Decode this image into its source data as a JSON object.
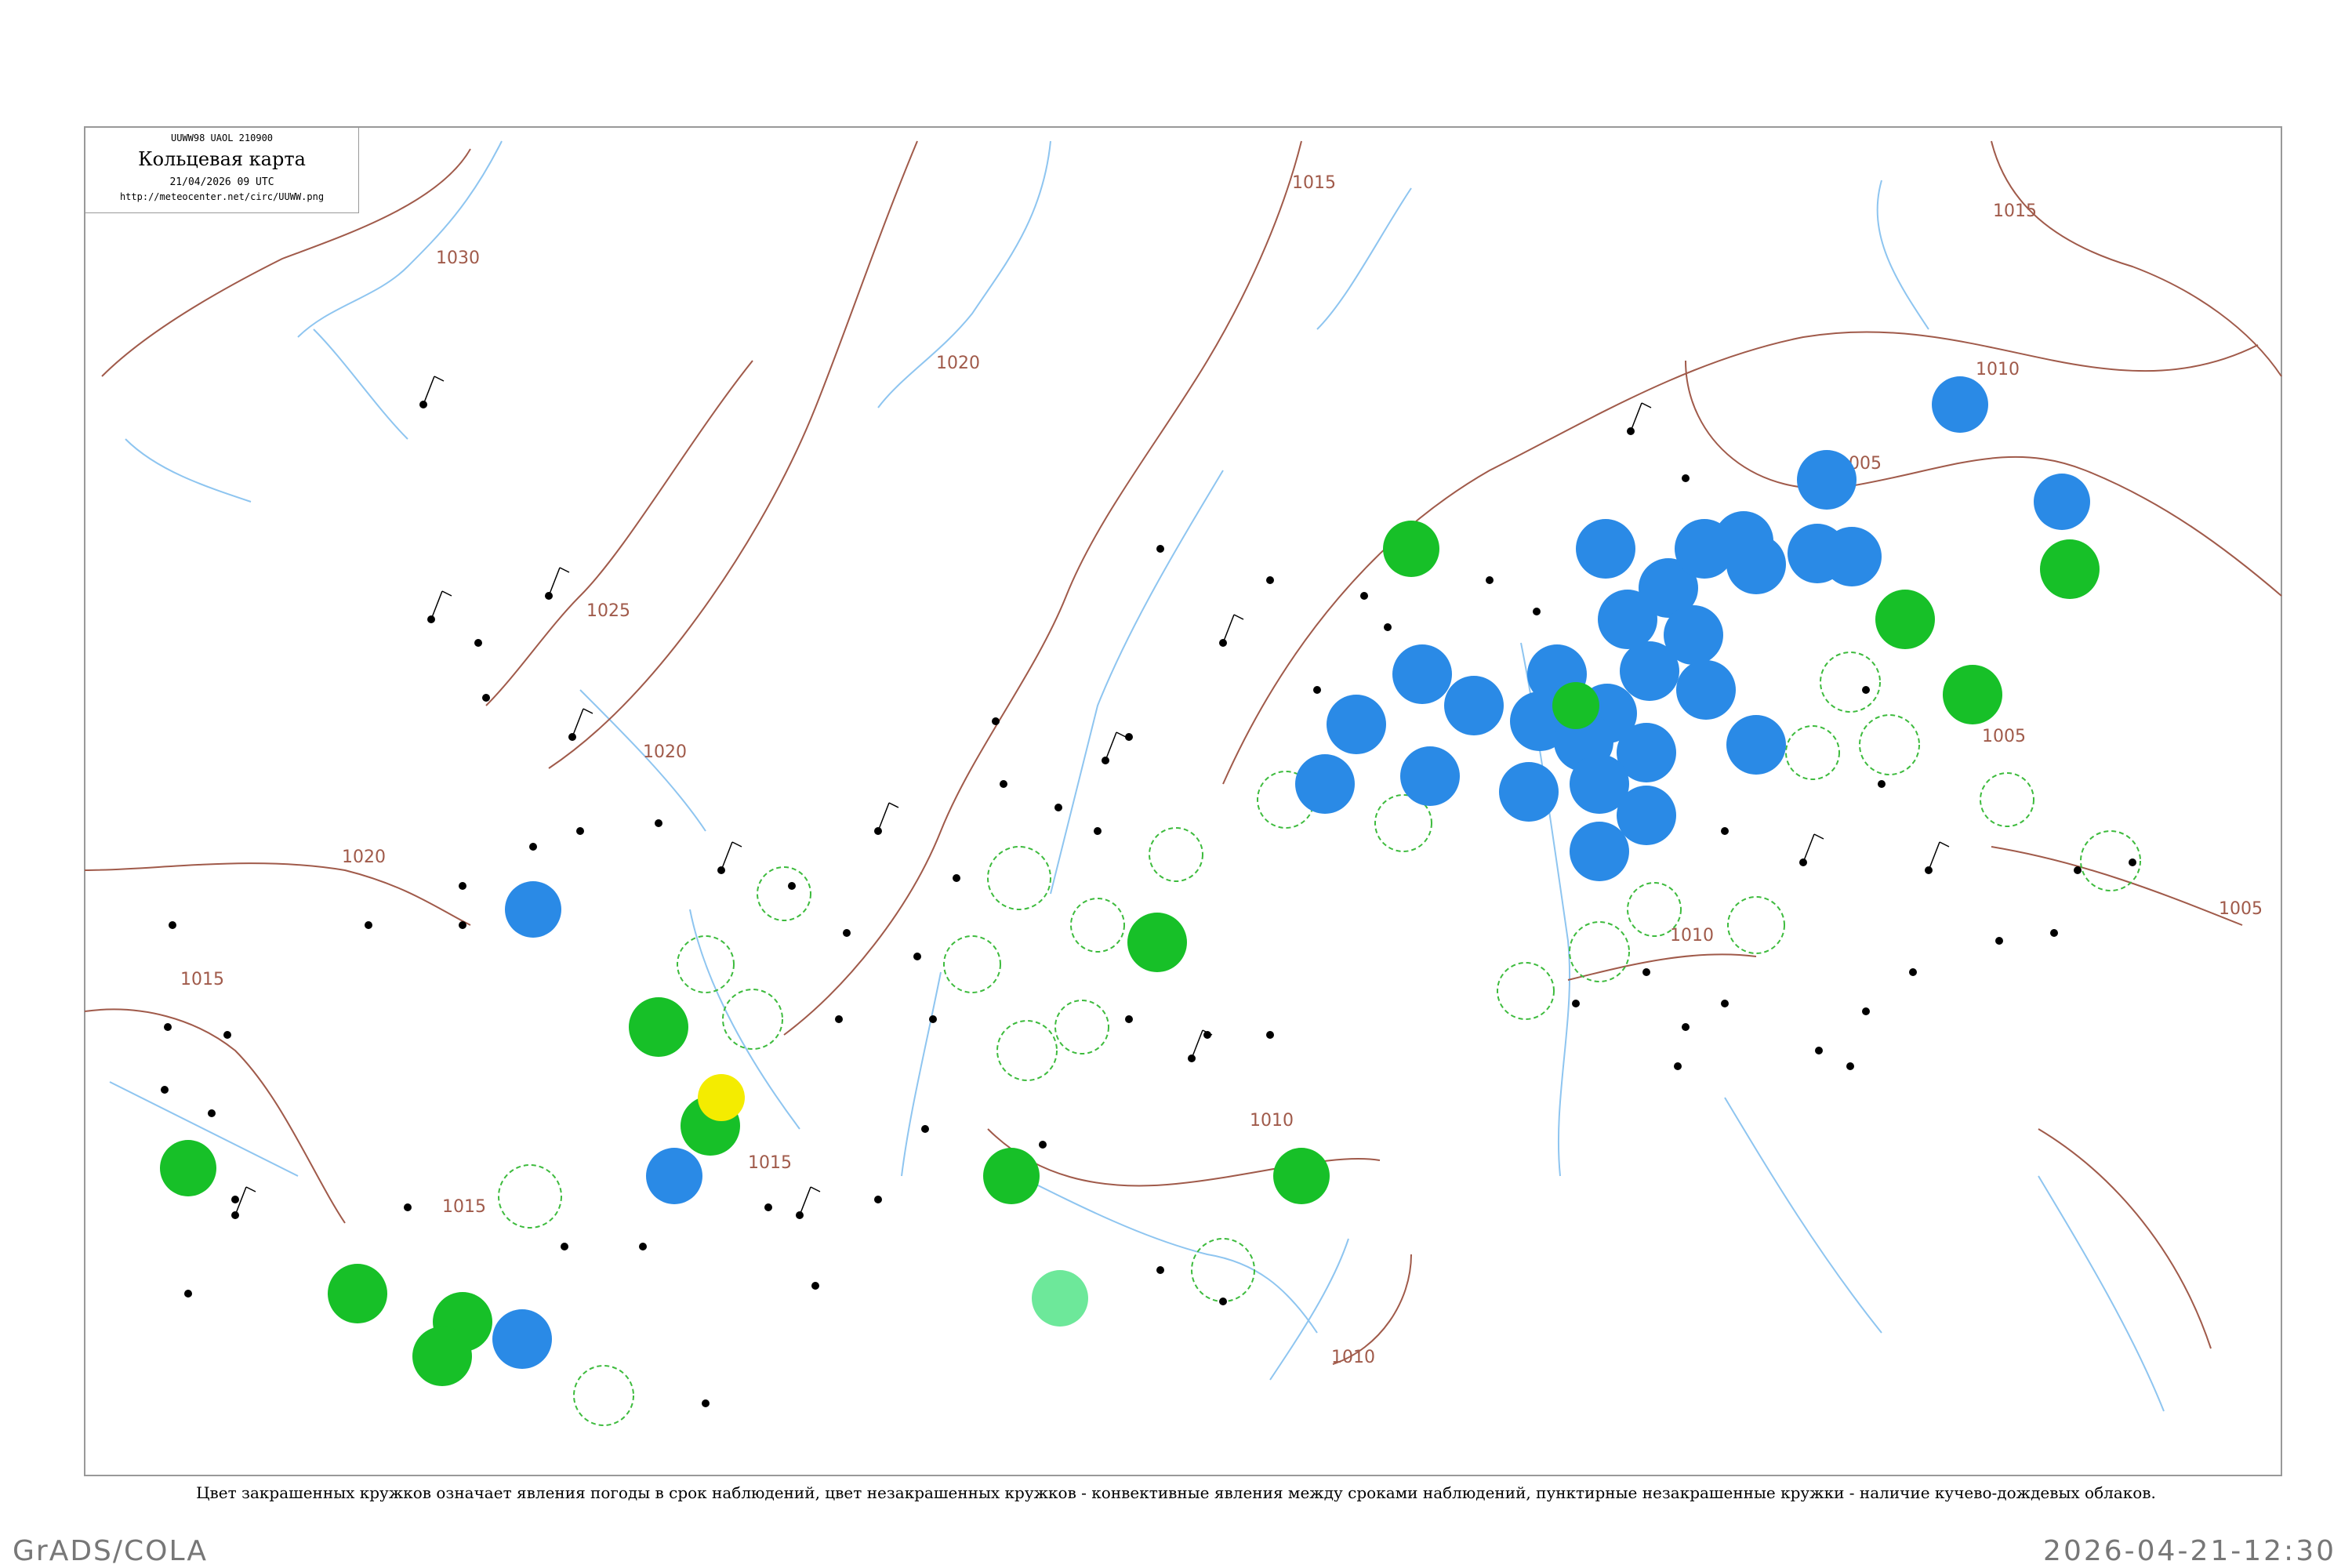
{
  "header": {
    "code": "UUWW98  UAOL  210900",
    "title": "Кольцевая карта",
    "date": "21/04/2026 09 UTC",
    "url": "http://meteocenter.net/circ/UUWW.png"
  },
  "isobars": [
    "1030",
    "1025",
    "1020",
    "1020",
    "1020",
    "1015",
    "1015",
    "1015",
    "1015",
    "1015",
    "1010",
    "1010",
    "1010",
    "1010",
    "1005",
    "1005",
    "1005"
  ],
  "footnote": "Цвет закрашенных кружков означает явления погоды в срок наблюдений, цвет незакрашенных кружков - конвективные явления между сроками наблюдений, пунктирные незакрашенные кружки - наличие кучево-дождевых облаков.",
  "footer": {
    "credit": "GrADS/COLA",
    "timestamp": "2026-04-21-12:30"
  },
  "colors": {
    "rain": "#2a8ae6",
    "snow_showers": "#17c028",
    "fog": "#f4ec00",
    "drizzle": "#6de89a",
    "convective_ring": "#3dbb3d",
    "isobar": "#a05a4a",
    "water": "#8ec5f0"
  }
}
